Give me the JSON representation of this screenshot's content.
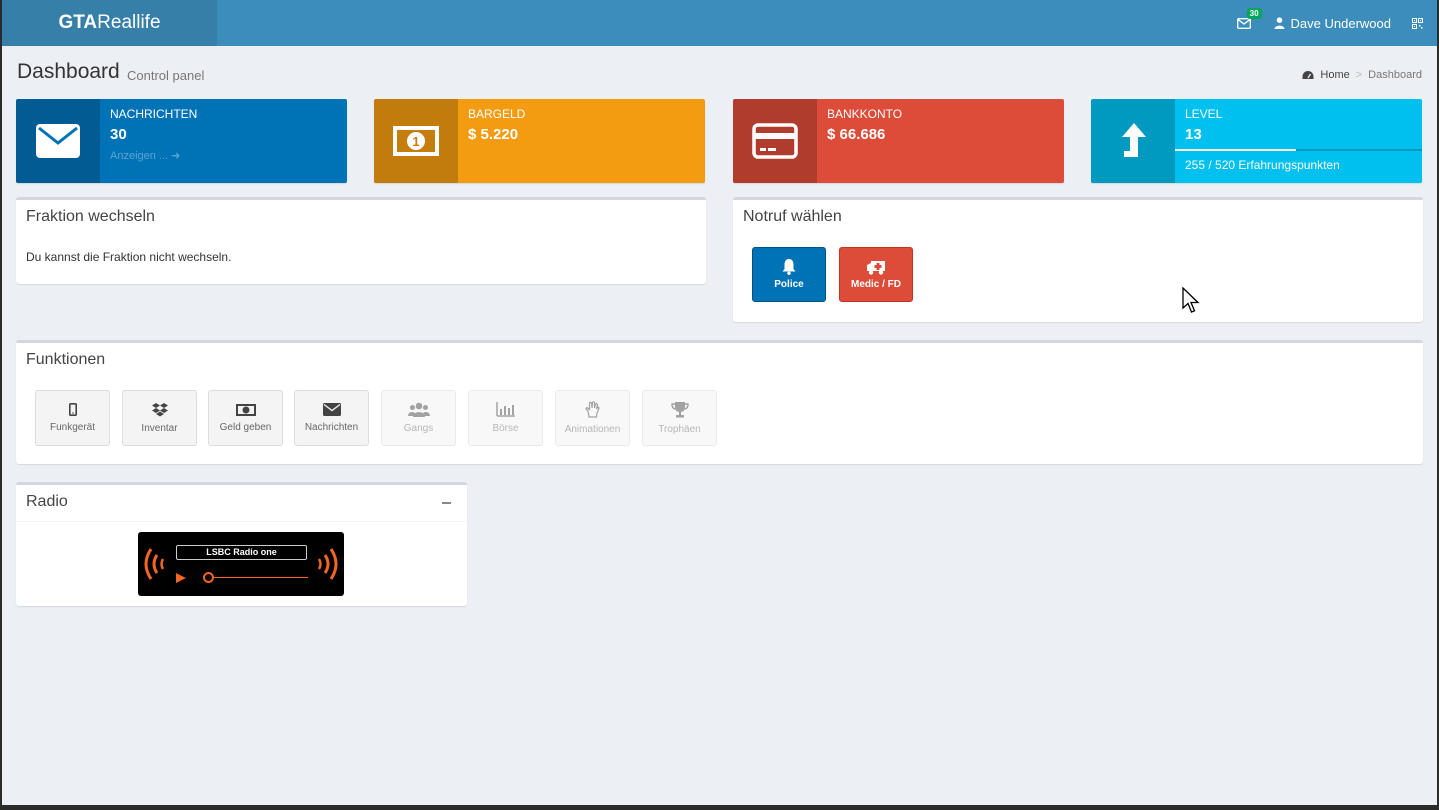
{
  "header": {
    "logo_bold": "GTA",
    "logo_rest": "Reallife",
    "mail_badge": "30",
    "user_name": "Dave Underwood"
  },
  "content_header": {
    "title": "Dashboard",
    "subtitle": "Control panel",
    "breadcrumb": {
      "home": "Home",
      "separator": ">",
      "current": "Dashboard"
    }
  },
  "info_boxes": [
    {
      "label": "NACHRICHTEN",
      "value": "30",
      "link": "Anzeigen ...",
      "color": "#0073b7",
      "icon": "envelope-icon"
    },
    {
      "label": "BARGELD",
      "value": "$ 5.220",
      "color": "#f39c12",
      "icon": "money-icon"
    },
    {
      "label": "BANKKONTO",
      "value": "$ 66.686",
      "color": "#dd4b39",
      "icon": "credit-card-icon"
    },
    {
      "label": "LEVEL",
      "value": "13",
      "progress": 0.49,
      "description": "255 / 520 Erfahrungspunkten",
      "color": "#00c0ef",
      "icon": "level-up-icon"
    }
  ],
  "fraktion": {
    "title": "Fraktion wechseln",
    "message": "Du kannst die Fraktion nicht wechseln."
  },
  "notruf": {
    "title": "Notruf wählen",
    "buttons": [
      {
        "label": "Police",
        "icon": "bell-icon",
        "color": "#0073b7"
      },
      {
        "label": "Medic / FD",
        "icon": "ambulance-icon",
        "color": "#dd4b39"
      }
    ]
  },
  "funktionen": {
    "title": "Funktionen",
    "buttons": [
      {
        "label": "Funkgerät",
        "icon": "mobile-icon",
        "enabled": true
      },
      {
        "label": "Inventar",
        "icon": "dropbox-icon",
        "enabled": true
      },
      {
        "label": "Geld geben",
        "icon": "money-icon",
        "enabled": true
      },
      {
        "label": "Nachrichten",
        "icon": "envelope-icon",
        "enabled": true
      },
      {
        "label": "Gangs",
        "icon": "users-icon",
        "enabled": false
      },
      {
        "label": "Börse",
        "icon": "bar-chart-icon",
        "enabled": false
      },
      {
        "label": "Animationen",
        "icon": "hand-icon",
        "enabled": false
      },
      {
        "label": "Trophäen",
        "icon": "trophy-icon",
        "enabled": false
      }
    ]
  },
  "radio": {
    "title": "Radio",
    "station": "LSBC Radio one",
    "accent": "#f26522"
  }
}
